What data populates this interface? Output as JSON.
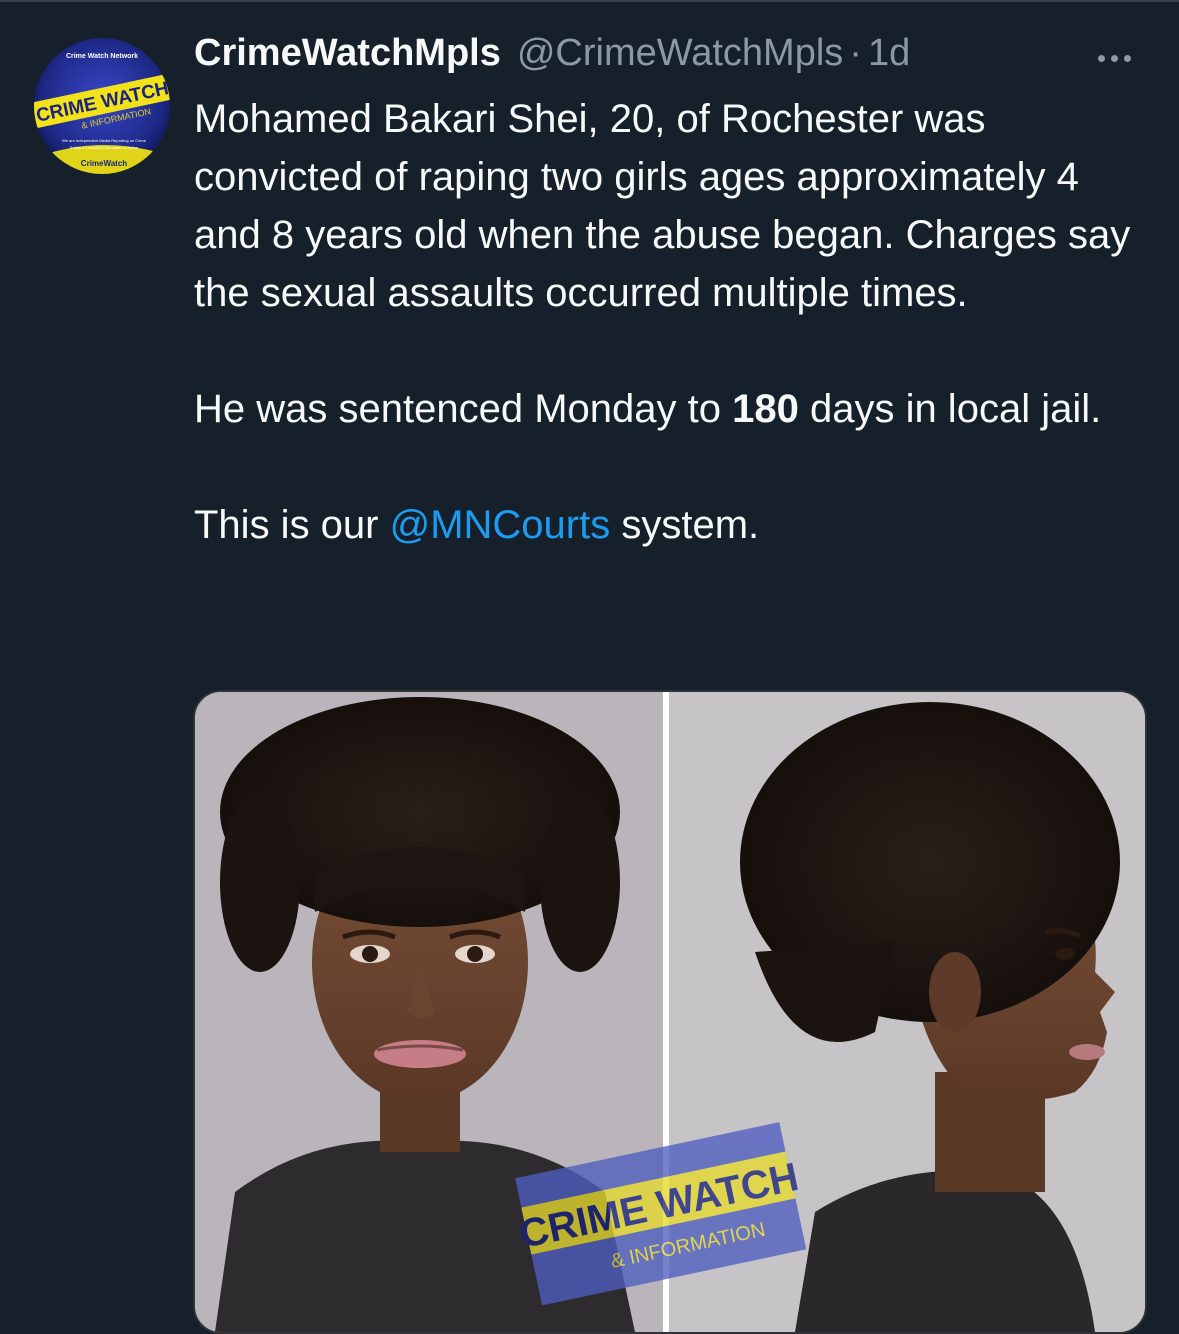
{
  "tweet": {
    "display_name": "CrimeWatchMpls",
    "handle": "@CrimeWatchMpls",
    "separator": "·",
    "time": "1d",
    "paragraphs": {
      "p1": "Mohamed Bakari Shei, 20, of Rochester was convicted of raping two girls ages approximately 4 and 8 years old when the abuse began. Charges say the sexual assaults occurred multiple times.",
      "p2_before": "He was sentenced Monday to ",
      "p2_bold": "180",
      "p2_after": " days in local jail.",
      "p3_before": "This is our ",
      "p3_mention": "@MNCourts",
      "p3_after": " system."
    }
  },
  "avatar": {
    "line1": "Crime Watch Network",
    "line2": "CRIME WATCH",
    "line3": "& INFORMATION",
    "line4": "We are Independent Media Reporting on Crime",
    "line5": "Safety & Livability Information & Action",
    "line6": "CrimeWatch"
  },
  "media": {
    "watermark_line1": "CRIME WATCH",
    "watermark_line2": "& INFORMATION"
  },
  "colors": {
    "background": "#15202b",
    "text": "#f7f9f9",
    "muted": "#8b98a5",
    "link": "#1d9bf0"
  },
  "icons": {
    "more": "more-horizontal-icon"
  }
}
